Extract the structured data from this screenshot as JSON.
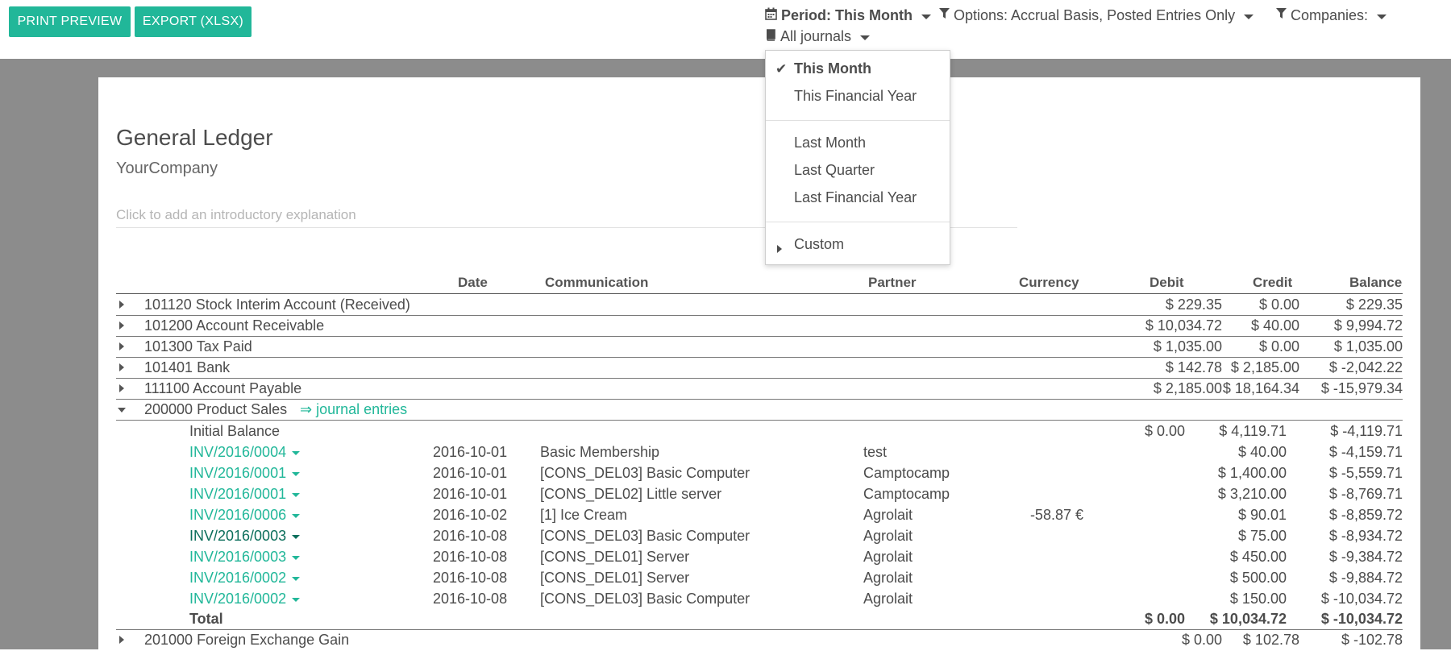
{
  "toolbar": {
    "print_label": "PRINT PREVIEW",
    "export_label": "EXPORT (XLSX)"
  },
  "filters": {
    "period_label": "Period: This Month",
    "options_label": "Options: Accrual Basis, Posted Entries Only",
    "companies_label": "Companies:",
    "journals_label": "All journals"
  },
  "period_menu": {
    "this_month": "This Month",
    "this_fy": "This Financial Year",
    "last_month": "Last Month",
    "last_quarter": "Last Quarter",
    "last_fy": "Last Financial Year",
    "custom": "Custom"
  },
  "report": {
    "title": "General Ledger",
    "company": "YourCompany",
    "intro_placeholder": "Click to add an introductory explanation"
  },
  "columns": {
    "date": "Date",
    "communication": "Communication",
    "partner": "Partner",
    "currency": "Currency",
    "debit": "Debit",
    "credit": "Credit",
    "balance": "Balance"
  },
  "accounts_top": [
    {
      "name": "101120 Stock Interim Account (Received)",
      "debit": "$ 229.35",
      "credit": "$ 0.00",
      "balance": "$ 229.35"
    },
    {
      "name": "101200 Account Receivable",
      "debit": "$ 10,034.72",
      "credit": "$ 40.00",
      "balance": "$ 9,994.72"
    },
    {
      "name": "101300 Tax Paid",
      "debit": "$ 1,035.00",
      "credit": "$ 0.00",
      "balance": "$ 1,035.00"
    },
    {
      "name": "101401 Bank",
      "debit": "$ 142.78",
      "credit": "$ 2,185.00",
      "balance": "$ -2,042.22"
    },
    {
      "name": "111100 Account Payable",
      "debit": "$ 2,185.00",
      "credit": "$ 18,164.34",
      "balance": "$ -15,979.34"
    }
  ],
  "expanded_account": {
    "name": "200000 Product Sales",
    "journal_link": "⇒ journal entries",
    "initial_label": "Initial Balance",
    "initial_debit": "$ 0.00",
    "initial_credit": "$ 4,119.71",
    "initial_balance": "$ -4,119.71",
    "lines": [
      {
        "ref": "INV/2016/0004",
        "date": "2016-10-01",
        "comm": "Basic Membership",
        "partner": "test",
        "currency": "",
        "credit": "$ 40.00",
        "balance": "$ -4,159.71"
      },
      {
        "ref": "INV/2016/0001",
        "date": "2016-10-01",
        "comm": "[CONS_DEL03] Basic Computer",
        "partner": "Camptocamp",
        "currency": "",
        "credit": "$ 1,400.00",
        "balance": "$ -5,559.71"
      },
      {
        "ref": "INV/2016/0001",
        "date": "2016-10-01",
        "comm": "[CONS_DEL02] Little server",
        "partner": "Camptocamp",
        "currency": "",
        "credit": "$ 3,210.00",
        "balance": "$ -8,769.71"
      },
      {
        "ref": "INV/2016/0006",
        "date": "2016-10-02",
        "comm": "[1] Ice Cream",
        "partner": "Agrolait",
        "currency": "-58.87 €",
        "credit": "$ 90.01",
        "balance": "$ -8,859.72"
      },
      {
        "ref": "INV/2016/0003",
        "date": "2016-10-08",
        "comm": "[CONS_DEL03] Basic Computer",
        "partner": "Agrolait",
        "currency": "",
        "credit": "$ 75.00",
        "balance": "$ -8,934.72"
      },
      {
        "ref": "INV/2016/0003",
        "date": "2016-10-08",
        "comm": "[CONS_DEL01] Server",
        "partner": "Agrolait",
        "currency": "",
        "credit": "$ 450.00",
        "balance": "$ -9,384.72"
      },
      {
        "ref": "INV/2016/0002",
        "date": "2016-10-08",
        "comm": "[CONS_DEL01] Server",
        "partner": "Agrolait",
        "currency": "",
        "credit": "$ 500.00",
        "balance": "$ -9,884.72"
      },
      {
        "ref": "INV/2016/0002",
        "date": "2016-10-08",
        "comm": "[CONS_DEL03] Basic Computer",
        "partner": "Agrolait",
        "currency": "",
        "credit": "$ 150.00",
        "balance": "$ -10,034.72"
      }
    ],
    "total_label": "Total",
    "total_debit": "$ 0.00",
    "total_credit": "$ 10,034.72",
    "total_balance": "$ -10,034.72"
  },
  "accounts_bottom": [
    {
      "name": "201000 Foreign Exchange Gain",
      "debit": "$ 0.00",
      "credit": "$ 102.78",
      "balance": "$ -102.78"
    }
  ]
}
